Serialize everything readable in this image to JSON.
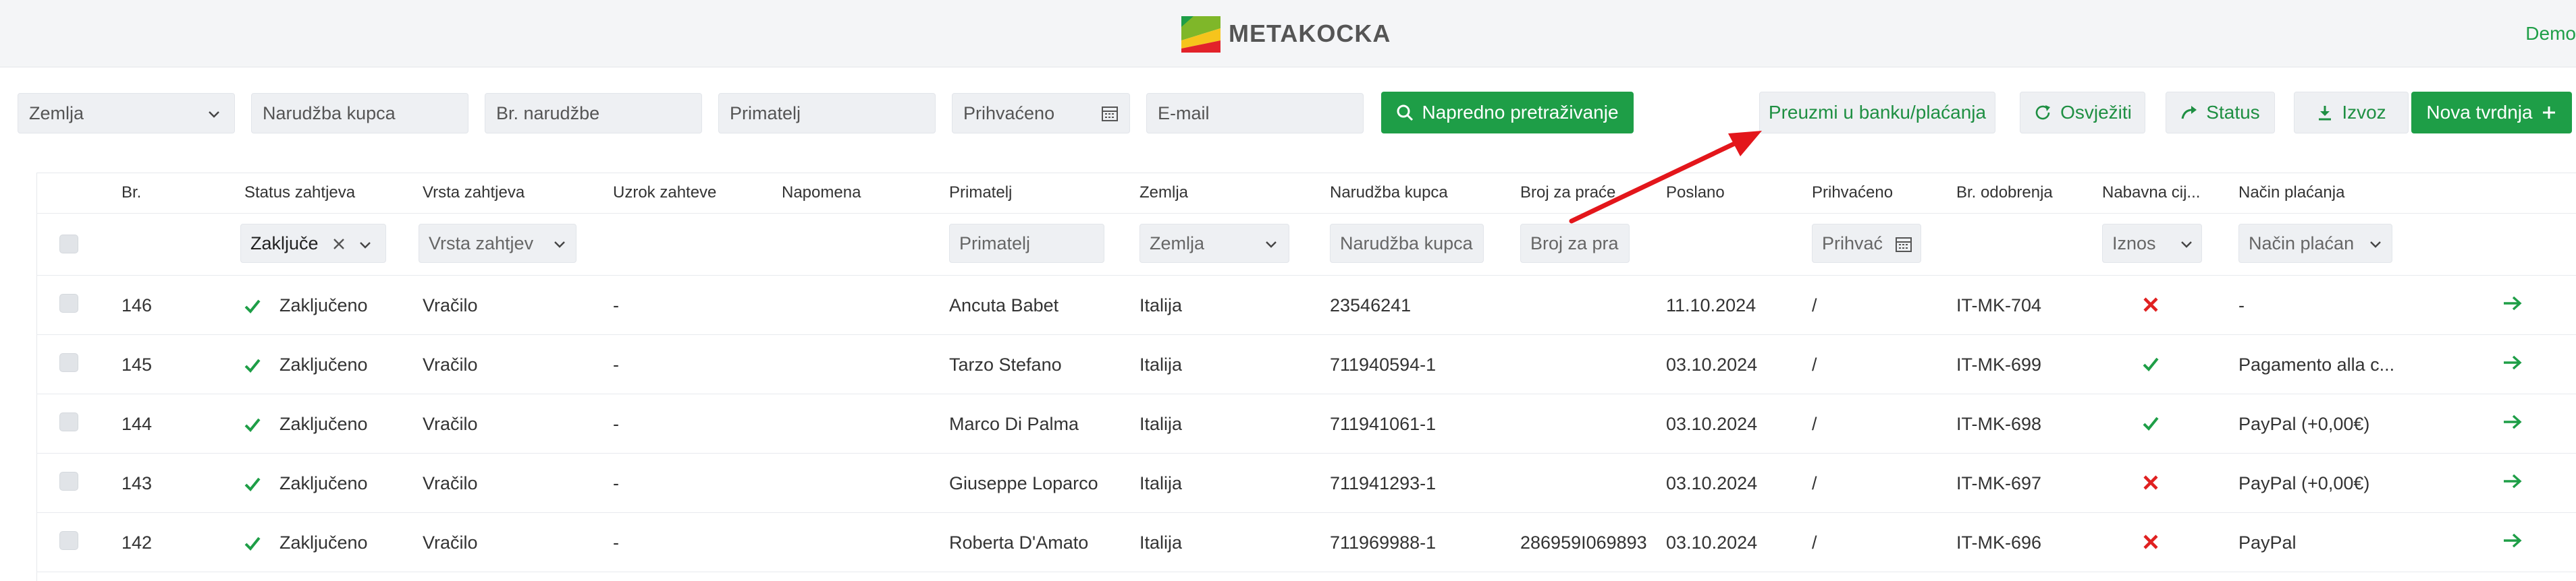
{
  "header": {
    "logo_text": "METAKOCKA",
    "user": "Demo",
    "logo_colors": [
      "#e2222a",
      "#f6c41c",
      "#7fb729",
      "#1e9e47"
    ]
  },
  "filters": {
    "country": "Zemlja",
    "customer_order": "Narudžba kupca",
    "order_no": "Br. narudžbe",
    "recipient": "Primatelj",
    "accepted": "Prihvaćeno",
    "email": "E-mail"
  },
  "toolbar": {
    "advanced_search": "Napredno pretraživanje",
    "bank_import": "Preuzmi u banku/plaćanja",
    "refresh": "Osvježiti",
    "status": "Status",
    "export": "Izvoz",
    "new": "Nova tvrdnja"
  },
  "columns": [
    "Br.",
    "Status zahtjeva",
    "Vrsta zahtjeva",
    "Uzrok zahteve",
    "Napomena",
    "Primatelj",
    "Zemlja",
    "Narudžba kupca",
    "Broj za praće",
    "Poslano",
    "Prihvaćeno",
    "Br. odobrenja",
    "Nabavna cij...",
    "Način plaćanja"
  ],
  "column_filters": {
    "status": "Zaključe",
    "type": "Vrsta zahtjev",
    "recipient": "Primatelj",
    "country": "Zemlja",
    "customer_order": "Narudžba kupca",
    "tracking": "Broj za pra",
    "accepted": "Prihvać",
    "amount": "Iznos",
    "payment": "Način plaćan"
  },
  "rows": [
    {
      "no": "146",
      "status": "Zaključeno",
      "type": "Vračilo",
      "cause": "-",
      "recipient": "Ancuta Babet",
      "country": "Italija",
      "order": "23546241",
      "tracking": "",
      "sent": "11.10.2024",
      "accepted": "/",
      "approval": "IT-MK-704",
      "purchase_ok": false,
      "payment": "-"
    },
    {
      "no": "145",
      "status": "Zaključeno",
      "type": "Vračilo",
      "cause": "-",
      "recipient": "Tarzo Stefano",
      "country": "Italija",
      "order": "711940594-1",
      "tracking": "",
      "sent": "03.10.2024",
      "accepted": "/",
      "approval": "IT-MK-699",
      "purchase_ok": true,
      "payment": "Pagamento alla c..."
    },
    {
      "no": "144",
      "status": "Zaključeno",
      "type": "Vračilo",
      "cause": "-",
      "recipient": "Marco Di Palma",
      "country": "Italija",
      "order": "711941061-1",
      "tracking": "",
      "sent": "03.10.2024",
      "accepted": "/",
      "approval": "IT-MK-698",
      "purchase_ok": true,
      "payment": "PayPal (+0,00€)"
    },
    {
      "no": "143",
      "status": "Zaključeno",
      "type": "Vračilo",
      "cause": "-",
      "recipient": "Giuseppe Loparco",
      "country": "Italija",
      "order": "711941293-1",
      "tracking": "",
      "sent": "03.10.2024",
      "accepted": "/",
      "approval": "IT-MK-697",
      "purchase_ok": false,
      "payment": "PayPal (+0,00€)"
    },
    {
      "no": "142",
      "status": "Zaključeno",
      "type": "Vračilo",
      "cause": "-",
      "recipient": "Roberta D'Amato",
      "country": "Italija",
      "order": "711969988-1",
      "tracking": "286959I069893",
      "sent": "03.10.2024",
      "accepted": "/",
      "approval": "IT-MK-696",
      "purchase_ok": false,
      "payment": "PayPal"
    }
  ],
  "colors": {
    "accent": "#1e9e47",
    "annotation_arrow": "#e3161b",
    "cross": "#e02020"
  }
}
